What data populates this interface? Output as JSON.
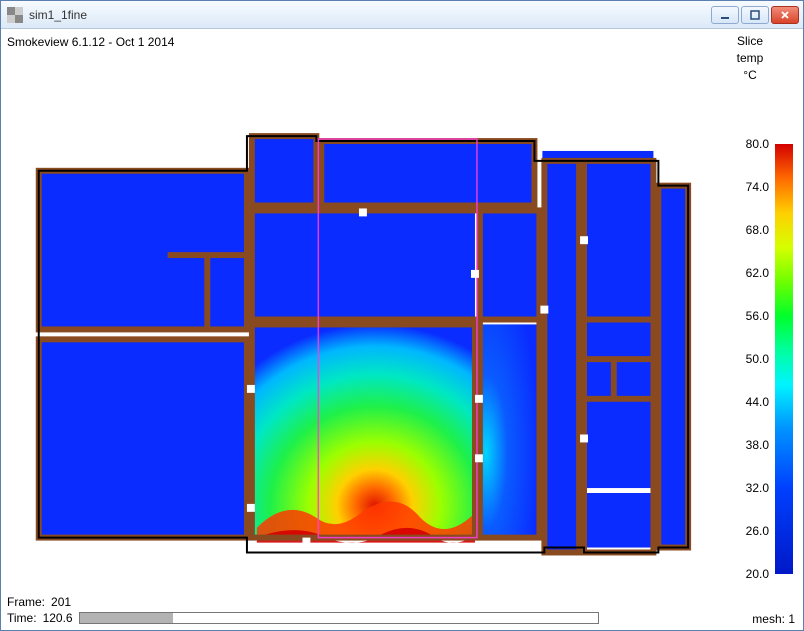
{
  "window": {
    "title": "sim1_1fine"
  },
  "app": {
    "version_line": "Smokeview 6.1.12 - Oct  1 2014"
  },
  "legend": {
    "line1": "Slice",
    "line2": "temp",
    "unit": "°C",
    "ticks": [
      "80.0",
      "74.0",
      "68.0",
      "62.0",
      "56.0",
      "50.0",
      "44.0",
      "38.0",
      "32.0",
      "26.0",
      "20.0"
    ]
  },
  "status": {
    "frame_label": "Frame:",
    "frame_value": "201",
    "time_label": "Time:",
    "time_value": "120.6",
    "mesh_label": "mesh:",
    "mesh_value": "1"
  },
  "progress": {
    "percent": 18
  },
  "chart_data": {
    "type": "heatmap",
    "title": "Slice temp",
    "unit": "°C",
    "value_range": [
      20.0,
      80.0
    ],
    "colorbar_ticks": [
      80.0,
      74.0,
      68.0,
      62.0,
      56.0,
      50.0,
      44.0,
      38.0,
      32.0,
      26.0,
      20.0
    ],
    "description": "Top-down temperature slice of a building floor plan. Most rooms are near ambient (~20 °C, deep blue). The large central-lower room (the fire room) shows a strong plume: a hot core near the bottom edge reaching ~75–80 °C (red/orange), transitioning through yellow (~60–70 °C) and green (~44–56 °C) across most of that room, fading to cyan (~30–38 °C) near its upper-left corner and doorway. Adjacent corridor to the right of the fire room shows slight warming (~26–32 °C cyan). All other perimeter rooms remain ~20 °C.",
    "rooms_estimate": [
      {
        "name": "fire_room",
        "approx_temp_range_c": [
          30,
          80
        ]
      },
      {
        "name": "corridor_east_of_fire_room",
        "approx_temp_range_c": [
          22,
          34
        ]
      },
      {
        "name": "all_other_rooms",
        "approx_temp_range_c": [
          20,
          22
        ]
      }
    ]
  }
}
